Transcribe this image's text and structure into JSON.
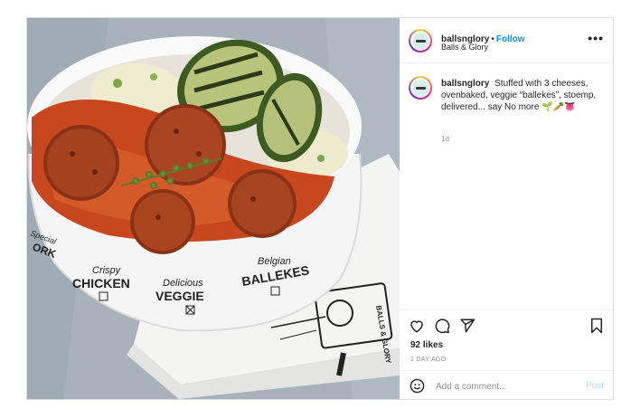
{
  "post": {
    "username": "ballsnglory",
    "follow_separator": "•",
    "follow_label": "Follow",
    "location": "Balls & Glory",
    "caption_text": "Stuffed with 3 cheeses, ovenbaked, veggie “ballekes”, stoemp, delivered... say No more",
    "caption_emojis": "🌱🥕👅",
    "time": "1d",
    "likes": "92 likes",
    "posted_ago": "1 DAY AGO",
    "comment_placeholder": "Add a comment...",
    "post_button": "Post"
  },
  "media": {
    "bowl_labels": {
      "crispy": "Crispy",
      "chicken": "CHICKEN",
      "delicious": "Delicious",
      "veggie": "VEGGIE",
      "belgian": "Belgian",
      "ballekes": "BALLEKES",
      "special": "Special",
      "ork": "ORK"
    },
    "napkin_label": "BALLS & GLORY"
  },
  "icons": {
    "more": "more-options-icon",
    "like": "heart-icon",
    "comment": "comment-icon",
    "share": "share-icon",
    "save": "bookmark-icon",
    "emoji": "emoji-icon"
  }
}
